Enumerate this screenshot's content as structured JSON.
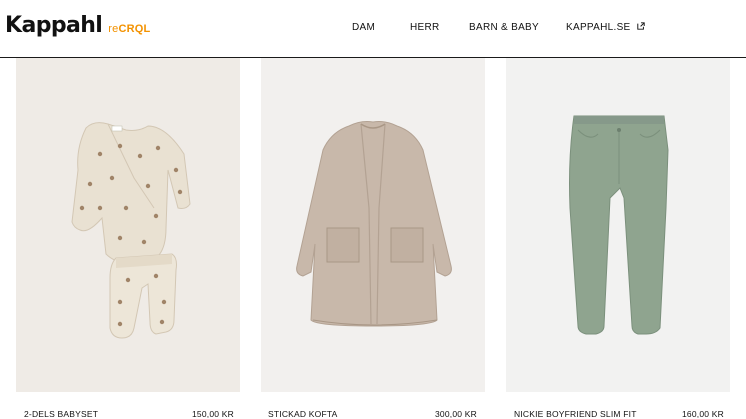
{
  "header": {
    "logo": "Kappahl",
    "logo_sub_prefix": "re",
    "logo_sub_suffix": "CRQL",
    "nav": [
      {
        "label": "DAM"
      },
      {
        "label": "HERR"
      },
      {
        "label": "BARN & BABY"
      },
      {
        "label": "KAPPAHL.SE",
        "icon": "external-link-icon"
      }
    ]
  },
  "colors": {
    "brand_accent": "#f39200",
    "card_bg_1": "#efebe6",
    "card_bg_2": "#f2f0ee",
    "card_bg_3": "#f2f2f1"
  },
  "products": [
    {
      "name": "2-DELS BABYSET",
      "price": "150,00 KR"
    },
    {
      "name": "STICKAD KOFTA",
      "price": "300,00 KR"
    },
    {
      "name": "NICKIE BOYFRIEND SLIM FIT",
      "price": "160,00 KR"
    }
  ]
}
